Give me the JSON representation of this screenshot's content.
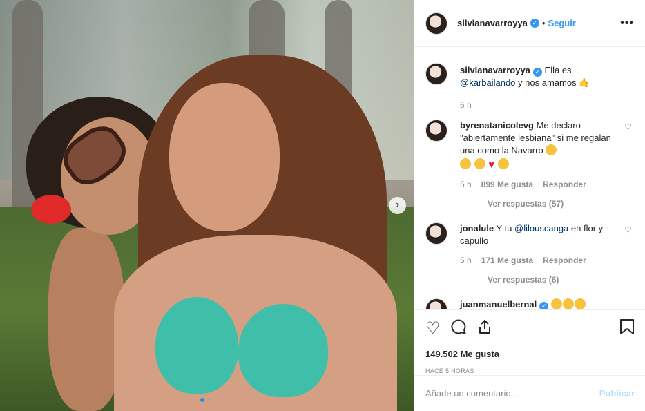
{
  "post": {
    "author": "silvianavarroyya",
    "follow_label": "Seguir",
    "more_label": "•••",
    "next_label": "›"
  },
  "comments": [
    {
      "user": "silvianavarroyya",
      "verified": true,
      "text_before": "Ella es",
      "mention": "@karbailando",
      "text_after": "y nos amamos 🤙",
      "time": "5 h"
    },
    {
      "user": "byrenatanicolevg",
      "text": "Me declaro \"abiertamente lesbiana\" si me regalan una como la Navarro",
      "time": "5 h",
      "likes": "899 Me gusta",
      "reply": "Responder",
      "view_replies": "Ver respuestas (57)"
    },
    {
      "user": "jonalule",
      "text_before": "Y tu",
      "mention": "@lilouscanga",
      "text_after": "en flor y capullo",
      "time": "5 h",
      "likes": "171 Me gusta",
      "reply": "Responder",
      "view_replies": "Ver respuestas (6)"
    },
    {
      "user": "juanmanuelbernal",
      "verified": true
    }
  ],
  "actions": {
    "likes_count": "149.502 Me gusta",
    "time_ago": "HACE 5 HORAS"
  },
  "composer": {
    "placeholder": "Añade un comentario...",
    "post_label": "Publicar"
  },
  "colors": {
    "accent": "#3897f0",
    "muted": "#8e8e8e"
  }
}
